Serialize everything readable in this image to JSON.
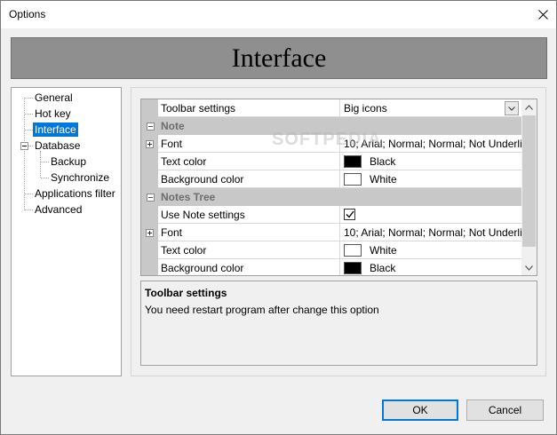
{
  "window": {
    "title": "Options"
  },
  "banner": {
    "title": "Interface"
  },
  "tree": {
    "items": [
      {
        "label": "General"
      },
      {
        "label": "Hot key"
      },
      {
        "label": "Interface"
      },
      {
        "label": "Database"
      },
      {
        "label": "Backup"
      },
      {
        "label": "Synchronize"
      },
      {
        "label": "Applications filter"
      },
      {
        "label": "Advanced"
      }
    ],
    "selected": "Interface"
  },
  "grid": {
    "toolbar": {
      "name": "Toolbar settings",
      "value": "Big icons"
    },
    "note_category": "Note",
    "note": {
      "font": {
        "name": "Font",
        "value": "10; Arial; Normal; Normal; Not Underli"
      },
      "text_color": {
        "name": "Text color",
        "value": "Black",
        "color": "#000000"
      },
      "background_color": {
        "name": "Background color",
        "value": "White",
        "color": "#ffffff"
      }
    },
    "notes_tree_category": "Notes Tree",
    "notes_tree": {
      "use_note_settings": {
        "name": "Use Note settings",
        "checked": true
      },
      "font": {
        "name": "Font",
        "value": "10; Arial; Normal; Normal; Not Underli"
      },
      "text_color": {
        "name": "Text color",
        "value": "White",
        "color": "#ffffff"
      },
      "background_color": {
        "name": "Background color",
        "value": "Black",
        "color": "#000000"
      }
    }
  },
  "description": {
    "title": "Toolbar settings",
    "text": "You need restart program after change this option"
  },
  "buttons": {
    "ok": "OK",
    "cancel": "Cancel"
  },
  "watermark": "SOFTPEDIA",
  "colors": {
    "selection": "#0078d7",
    "banner": "#8f8f8f",
    "category": "#c8c8c8"
  }
}
